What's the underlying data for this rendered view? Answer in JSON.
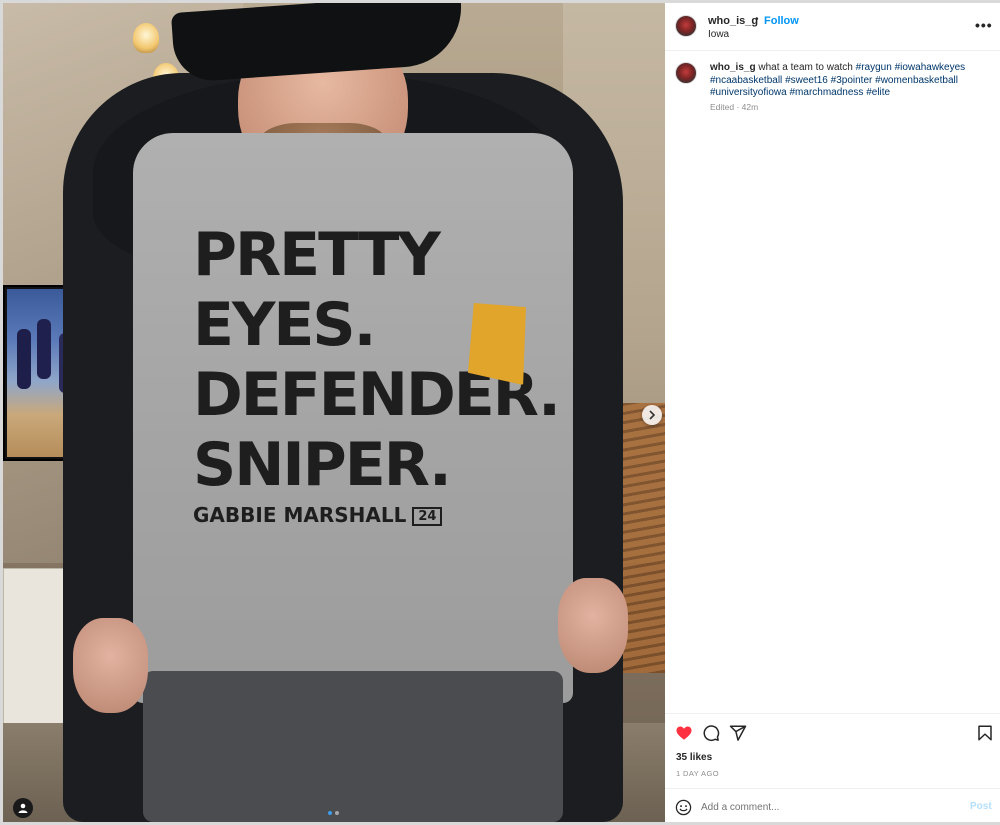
{
  "post": {
    "username": "who_is_g",
    "separator": "•",
    "follow_label": "Follow",
    "location": "Iowa",
    "more_icon": "more-horizontal-icon"
  },
  "caption": {
    "username": "who_is_g",
    "text": "what a team to watch",
    "hashtags": [
      "#raygun",
      "#iowahawkeyes",
      "#ncaabasketball",
      "#sweet16",
      "#3pointer",
      "#womenbasketball",
      "#universityofiowa",
      "#marchmadness",
      "#elite"
    ],
    "meta": "Edited · 42m"
  },
  "media": {
    "shirt_lines": [
      "PRETTY",
      "EYES.",
      "DEFENDER.",
      "SNIPER."
    ],
    "shirt_name": "GABBIE MARSHALL",
    "shirt_number": "24",
    "next_icon": "chevron-right-icon",
    "slide_count": 2,
    "active_slide": 1
  },
  "actions": {
    "like_icon": "heart-icon",
    "comment_icon": "comment-icon",
    "share_icon": "send-icon",
    "save_icon": "bookmark-icon",
    "liked": true,
    "likes": "35 likes",
    "time": "1 DAY AGO"
  },
  "comment": {
    "placeholder": "Add a comment...",
    "post_label": "Post",
    "emoji_icon": "emoji-icon"
  },
  "colors": {
    "follow": "#0095f6",
    "hashtag": "#00376b",
    "like": "#ff3040",
    "post_disabled": "#b2dffc"
  }
}
